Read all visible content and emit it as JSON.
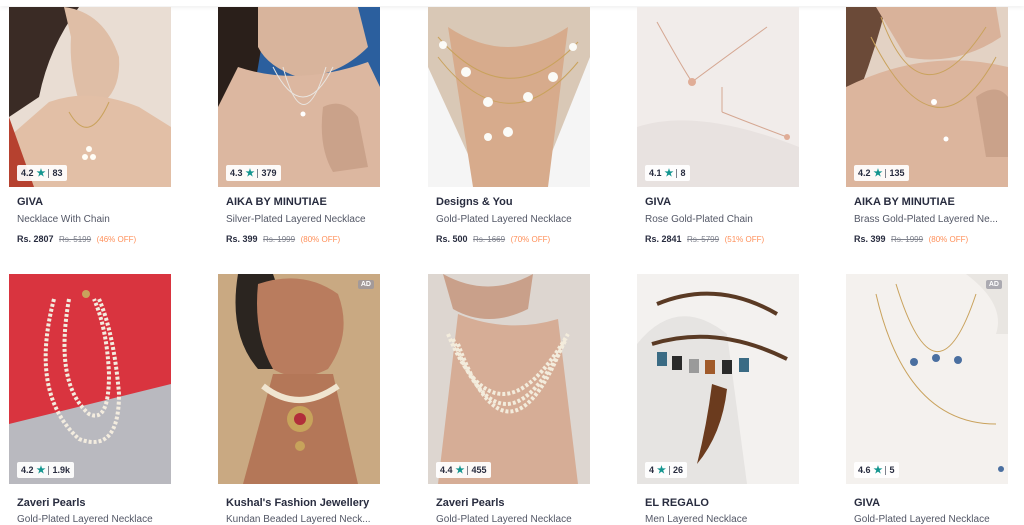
{
  "products": [
    {
      "brand": "GIVA",
      "name": "Necklace With Chain",
      "price": "Rs. 2807",
      "mrp": "Rs. 5199",
      "discount": "(46% OFF)",
      "rating": "4.2",
      "reviews": "83",
      "ad": "",
      "bg": "#e9ddd3"
    },
    {
      "brand": "AIKA BY MINUTIAE",
      "name": "Silver-Plated Layered Necklace",
      "price": "Rs. 399",
      "mrp": "Rs. 1999",
      "discount": "(80% OFF)",
      "rating": "4.3",
      "reviews": "379",
      "ad": "",
      "bg": "#2b5f9e"
    },
    {
      "brand": "Designs & You",
      "name": "Gold-Plated Layered Necklace",
      "price": "Rs. 500",
      "mrp": "Rs. 1669",
      "discount": "(70% OFF)",
      "rating": "",
      "reviews": "",
      "ad": "",
      "bg": "#d9c8b6"
    },
    {
      "brand": "GIVA",
      "name": "Rose Gold-Plated Chain",
      "price": "Rs. 2841",
      "mrp": "Rs. 5799",
      "discount": "(51% OFF)",
      "rating": "4.1",
      "reviews": "8",
      "ad": "",
      "bg": "#f1ecea"
    },
    {
      "brand": "AIKA BY MINUTIAE",
      "name": "Brass Gold-Plated Layered Ne...",
      "price": "Rs. 399",
      "mrp": "Rs. 1999",
      "discount": "(80% OFF)",
      "rating": "4.2",
      "reviews": "135",
      "ad": "",
      "bg": "#e3d2c4"
    },
    {
      "brand": "Zaveri Pearls",
      "name": "Gold-Plated Layered Necklace",
      "price": "",
      "mrp": "",
      "discount": "",
      "rating": "4.2",
      "reviews": "1.9k",
      "ad": "",
      "bg": "#d9343f"
    },
    {
      "brand": "Kushal's Fashion Jewellery",
      "name": "Kundan Beaded Layered Neck...",
      "price": "",
      "mrp": "",
      "discount": "",
      "rating": "",
      "reviews": "",
      "ad": "AD",
      "bg": "#c9a982"
    },
    {
      "brand": "Zaveri Pearls",
      "name": "Gold-Plated Layered Necklace",
      "price": "",
      "mrp": "",
      "discount": "",
      "rating": "4.4",
      "reviews": "455",
      "ad": "",
      "bg": "#ddd6d0"
    },
    {
      "brand": "EL REGALO",
      "name": "Men Layered Necklace",
      "price": "",
      "mrp": "",
      "discount": "",
      "rating": "4",
      "reviews": "26",
      "ad": "",
      "bg": "#f3f1ef"
    },
    {
      "brand": "GIVA",
      "name": "Gold-Plated Layered Necklace",
      "price": "",
      "mrp": "",
      "discount": "",
      "rating": "4.6",
      "reviews": "5",
      "ad": "AD",
      "bg": "#f4f1ee"
    }
  ],
  "icons": {
    "rating": "star-icon"
  }
}
